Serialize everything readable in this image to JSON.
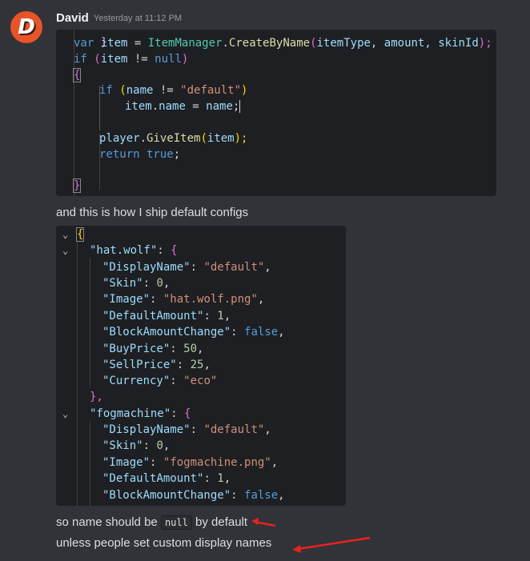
{
  "message": {
    "author": "David",
    "avatar_letter": "D",
    "timestamp": "Yesterday at 11:12 PM",
    "text_between": "and this is how I ship default configs",
    "line_a_before": "so name should be",
    "line_a_code": "null",
    "line_a_after": "by default",
    "line_b": "unless people set custom display names"
  },
  "code_block_1": {
    "partial_top": "}",
    "l1": {
      "kw": "var",
      "name": "item",
      "eq": " = ",
      "cls": "ItemManager",
      "dot": ".",
      "fn": "CreateByName",
      "open": "(",
      "args": "itemType, amount, skinId",
      "close": ");"
    },
    "l2": {
      "kw": "if",
      "open": " (",
      "var": "item",
      "op": " != ",
      "kw2": "null",
      "close": ")"
    },
    "l3": "{",
    "l4": {
      "kw": "if",
      "open": " (",
      "var": "name",
      "op": " != ",
      "str": "\"default\"",
      "close": ")"
    },
    "l5": {
      "a": "item",
      "dot": ".",
      "b": "name",
      "op": " = ",
      "c": "name",
      "semi": ";"
    },
    "l6": {
      "a": "player",
      "dot": ".",
      "fn": "GiveItem",
      "open": "(",
      "arg": "item",
      "close": ");"
    },
    "l7": {
      "kw": "return",
      "val": " true",
      "semi": ";"
    },
    "l8": "}"
  },
  "code_block_2": {
    "open_brace": "{",
    "hat_key": "\"hat.wolf\"",
    "hat_props": [
      {
        "key": "\"DisplayName\"",
        "value": "\"default\"",
        "type": "str"
      },
      {
        "key": "\"Skin\"",
        "value": "0",
        "type": "num"
      },
      {
        "key": "\"Image\"",
        "value": "\"hat.wolf.png\"",
        "type": "str"
      },
      {
        "key": "\"DefaultAmount\"",
        "value": "1",
        "type": "num"
      },
      {
        "key": "\"BlockAmountChange\"",
        "value": "false",
        "type": "kw"
      },
      {
        "key": "\"BuyPrice\"",
        "value": "50",
        "type": "num"
      },
      {
        "key": "\"SellPrice\"",
        "value": "25",
        "type": "num"
      },
      {
        "key": "\"Currency\"",
        "value": "\"eco\"",
        "type": "str"
      }
    ],
    "close_obj": "},",
    "fog_key": "\"fogmachine\"",
    "fog_props": [
      {
        "key": "\"DisplayName\"",
        "value": "\"default\"",
        "type": "str"
      },
      {
        "key": "\"Skin\"",
        "value": "0",
        "type": "num"
      },
      {
        "key": "\"Image\"",
        "value": "\"fogmachine.png\"",
        "type": "str"
      },
      {
        "key": "\"DefaultAmount\"",
        "value": "1",
        "type": "num"
      },
      {
        "key": "\"BlockAmountChange\"",
        "value": "false",
        "type": "kw"
      }
    ]
  },
  "colors": {
    "background": "#313338",
    "code_background": "#1e1f22",
    "arrow": "#e8221e",
    "avatar": "#e8542a"
  }
}
